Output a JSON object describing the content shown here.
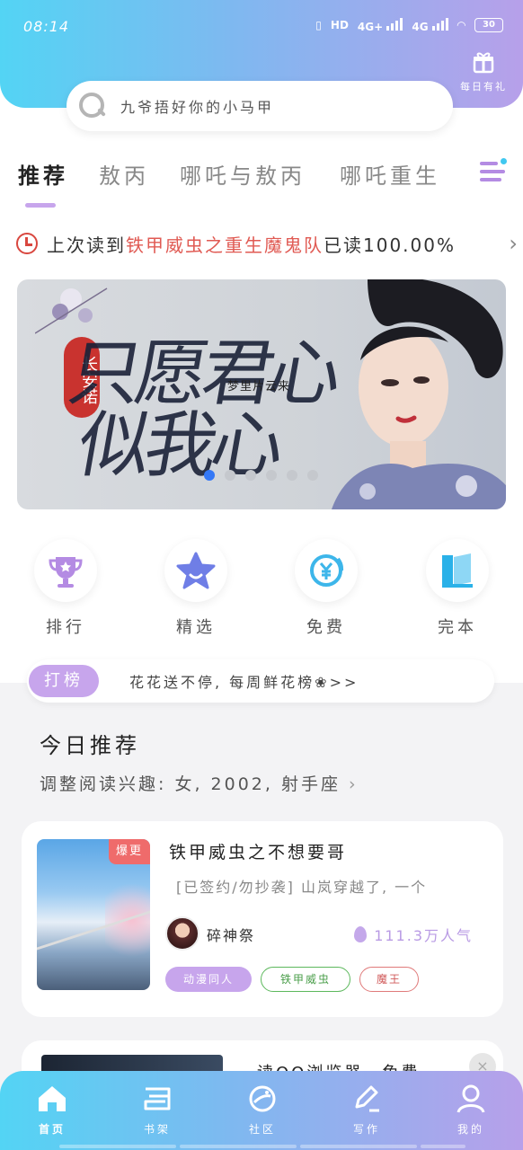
{
  "status_bar": {
    "time": "08:14",
    "network1": "4G+",
    "network2": "4G",
    "hd": "HD",
    "battery": "30"
  },
  "header": {
    "gift_label": "每日有礼",
    "search_placeholder": "九爷捂好你的小马甲"
  },
  "tabs": [
    "推荐",
    "敖丙",
    "哪吒与敖丙",
    "哪吒重生"
  ],
  "last_read": {
    "prefix": "上次读到",
    "book": "铁甲威虫之重生魔鬼队",
    "suffix": "已读100.00%"
  },
  "banner": {
    "seal_text": "长安诺",
    "ink_line1": "只愿君心",
    "ink_line2": "似我心",
    "author": "梦里片云来",
    "slide_count": 6,
    "active_slide": 0
  },
  "quick_actions": [
    {
      "label": "排行",
      "icon": "trophy-icon"
    },
    {
      "label": "精选",
      "icon": "star-icon"
    },
    {
      "label": "免费",
      "icon": "yuan-icon"
    },
    {
      "label": "完本",
      "icon": "book-icon"
    }
  ],
  "rank_bar": {
    "badge": "打榜",
    "text": "花花送不停, 每周鲜花榜❀>>"
  },
  "recommend": {
    "title": "今日推荐",
    "subtitle": "调整阅读兴趣: 女, 2002, 射手座"
  },
  "book_card": {
    "badge": "爆更",
    "title": "铁甲威虫之不想要哥",
    "desc": "[已签约/勿抄袭] 山岚穿越了, 一个",
    "author": "碎神祭",
    "popularity": "111.3万人气",
    "tags": [
      "动漫同人",
      "铁甲威虫",
      "魔王"
    ]
  },
  "second_card": {
    "title": "读QQ浏览器，免费"
  },
  "bottom_nav": [
    {
      "label": "首页",
      "icon": "home-icon",
      "active": true
    },
    {
      "label": "书架",
      "icon": "bookshelf-icon",
      "active": false
    },
    {
      "label": "社区",
      "icon": "planet-icon",
      "active": false
    },
    {
      "label": "写作",
      "icon": "pen-icon",
      "active": false
    },
    {
      "label": "我的",
      "icon": "user-icon",
      "active": false
    }
  ],
  "colors": {
    "gradient_start": "#53d4f4",
    "gradient_end": "#b7a0ea",
    "accent": "#c7a5ec",
    "highlight": "#e05a53"
  }
}
